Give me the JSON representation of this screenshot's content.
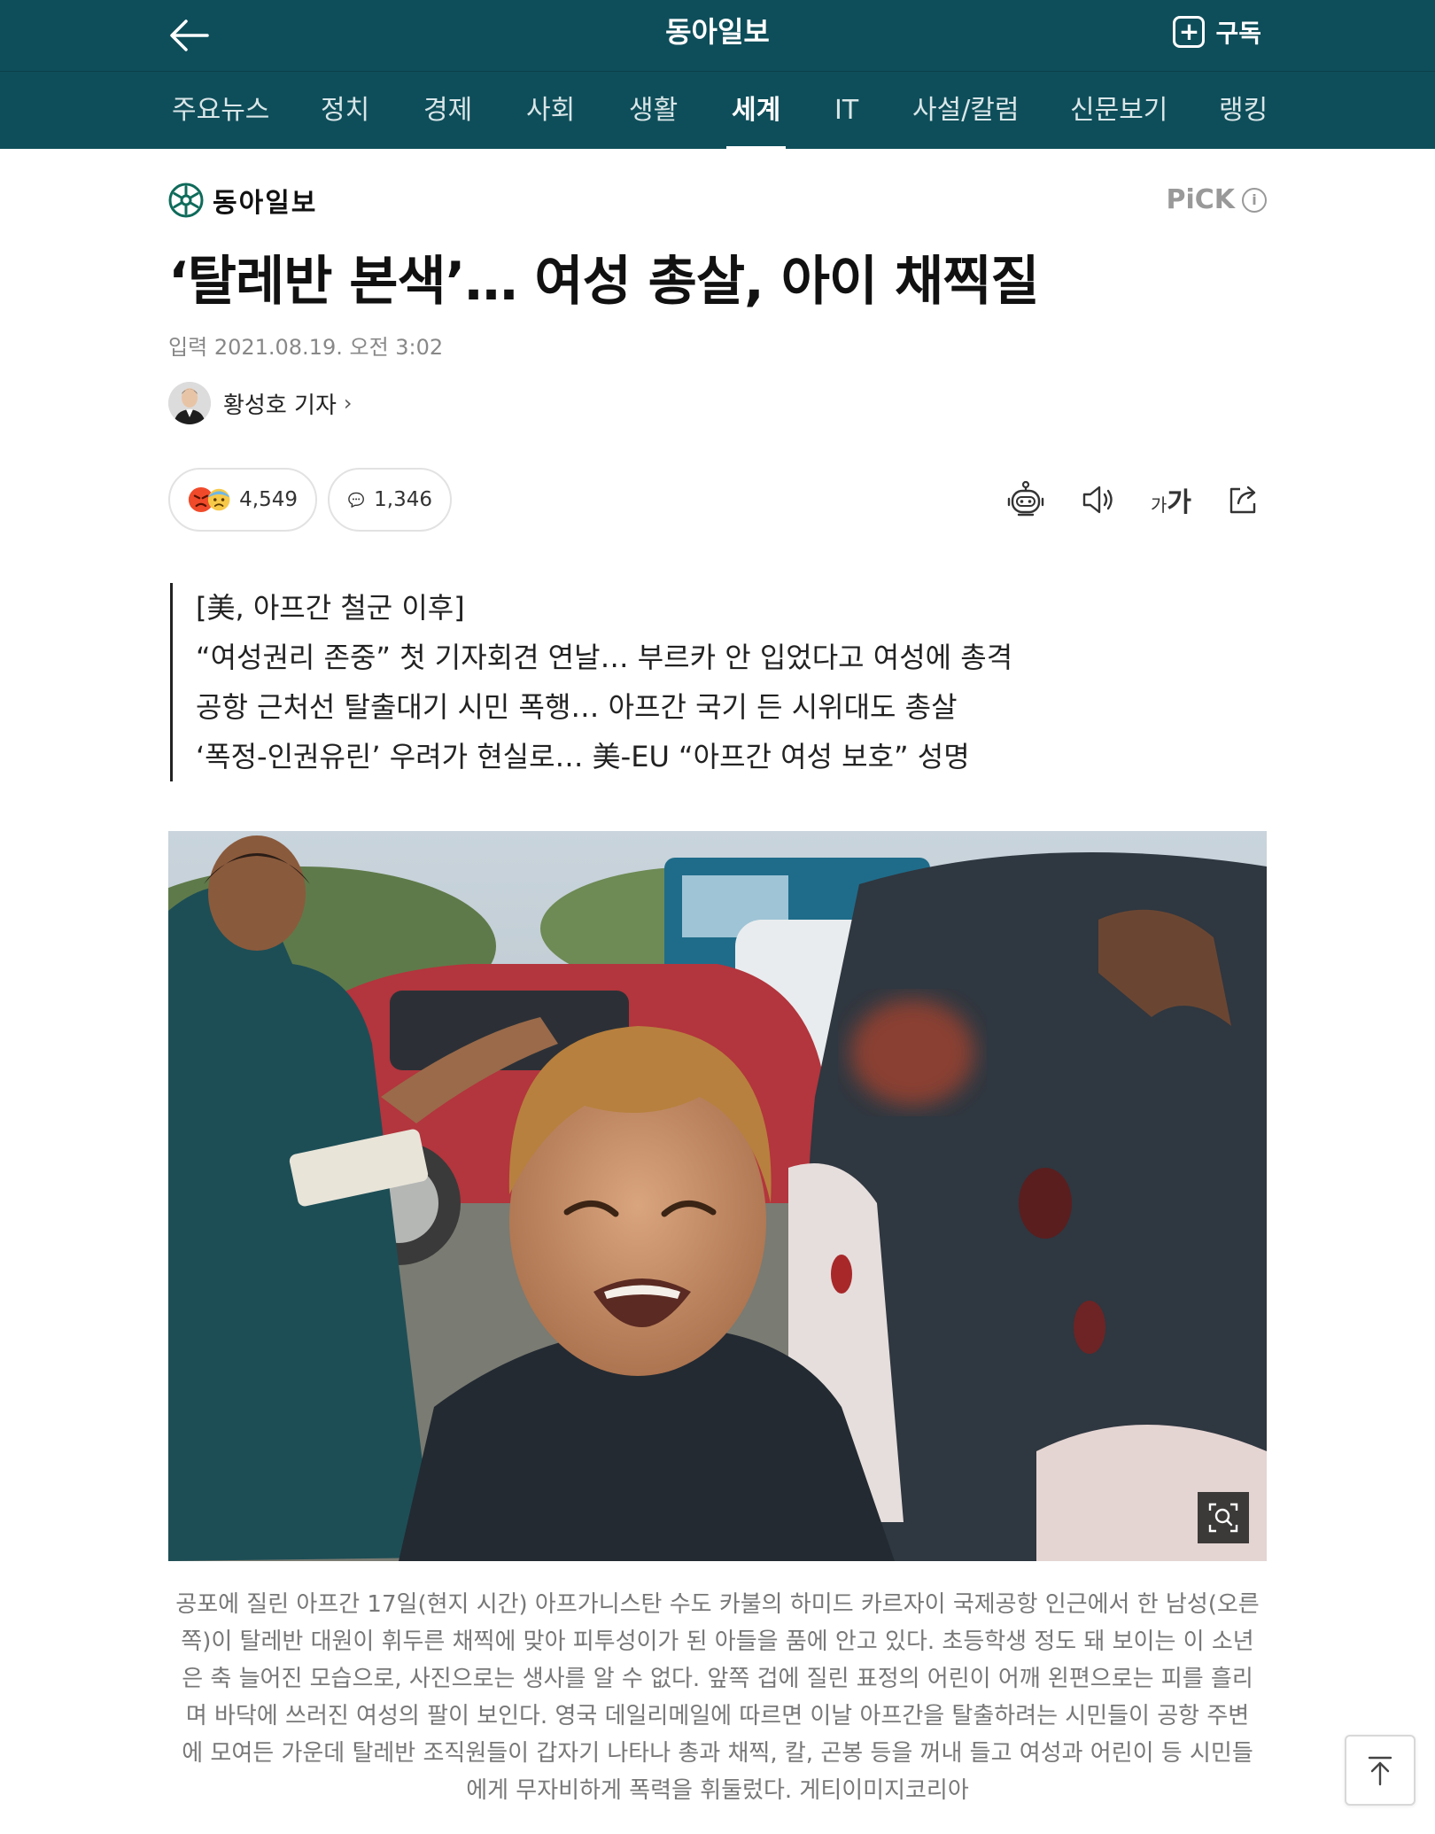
{
  "header": {
    "site_title": "동아일보",
    "subscribe_label": "구독"
  },
  "nav": {
    "items": [
      {
        "label": "주요뉴스"
      },
      {
        "label": "정치"
      },
      {
        "label": "경제"
      },
      {
        "label": "사회"
      },
      {
        "label": "생활"
      },
      {
        "label": "세계",
        "active": true
      },
      {
        "label": "IT"
      },
      {
        "label": "사설/칼럼"
      },
      {
        "label": "신문보기"
      },
      {
        "label": "랭킹"
      }
    ]
  },
  "brand": {
    "name": "동아일보",
    "pick_label": "PiCK",
    "pick_info": "i"
  },
  "article": {
    "headline": "‘탈레반 본색’… 여성 총살, 아이 채찍질",
    "date_label": "입력",
    "date": "2021.08.19. 오전 3:02",
    "author": "황성호 기자",
    "reaction_count": "4,549",
    "comment_count": "1,346",
    "font_size_label_small": "가",
    "font_size_label_large": "가",
    "summary": [
      "[美, 아프간 철군 이후]",
      "“여성권리 존중” 첫 기자회견 연날… 부르카 안 입었다고 여성에 총격",
      "공항 근처선 탈출대기 시민 폭행… 아프간 국기 든 시위대도 총살",
      "‘폭정-인권유린’ 우려가 현실로… 美-EU “아프간 여성 보호” 성명"
    ],
    "caption": "공포에 질린 아프간 17일(현지 시간) 아프가니스탄 수도 카불의 하미드 카르자이 국제공항 인근에서 한 남성(오른쪽)이 탈레반 대원이 휘두른 채찍에 맞아 피투성이가 된 아들을 품에 안고 있다. 초등학생 정도 돼 보이는 이 소년은 축 늘어진 모습으로, 사진으로는 생사를 알 수 없다. 앞쪽 겁에 질린 표정의 어린이 어깨 왼편으로는 피를 흘리며 바닥에 쓰러진 여성의 팔이 보인다. 영국 데일리메일에 따르면 이날 아프간을 탈출하려는 시민들이 공항 주변에 모여든 가운데 탈레반 조직원들이 갑자기 나타나 총과 채찍, 칼, 곤봉 등을 꺼내 들고 여성과 어린이 등 시민들에게 무자비하게 폭력을 휘둘렀다. 게티이미지코리아"
  },
  "colors": {
    "header_bg": "#0e4e5a",
    "brand_green": "#0e6b5a",
    "reaction_red": "#f04a2a",
    "reaction_blue": "#6fb7e6"
  },
  "icons": {
    "back": "arrow-left-icon",
    "subscribe": "plus-square-icon",
    "brand": "snowflake-logo-icon",
    "pick_info": "info-circle-icon",
    "author_chevron": "chevron-right-icon",
    "reaction_angry": "angry-face-icon",
    "reaction_sad": "sad-face-icon",
    "comment": "speech-bubble-icon",
    "robot": "robot-icon",
    "speaker": "speaker-icon",
    "font_size": "font-size-icon",
    "share": "share-icon",
    "zoom": "zoom-icon",
    "scroll_top": "arrow-up-icon"
  }
}
